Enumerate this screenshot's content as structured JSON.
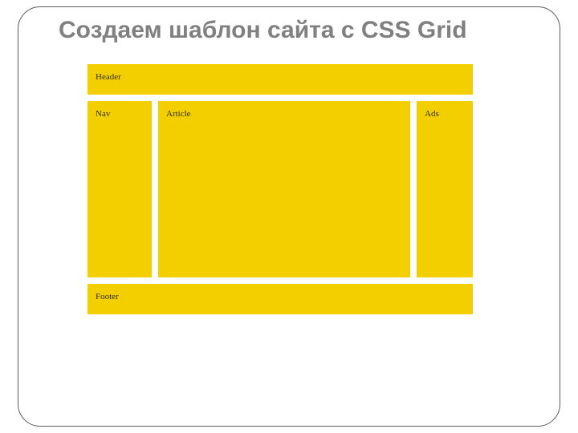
{
  "slide": {
    "title": "Создаем шаблон сайта с CSS Grid"
  },
  "layout": {
    "header": "Header",
    "nav": "Nav",
    "article": "Article",
    "ads": "Ads",
    "footer": "Footer"
  },
  "colors": {
    "title": "#808080",
    "cell_bg": "#f3cf00",
    "border": "#5a5a5a"
  }
}
